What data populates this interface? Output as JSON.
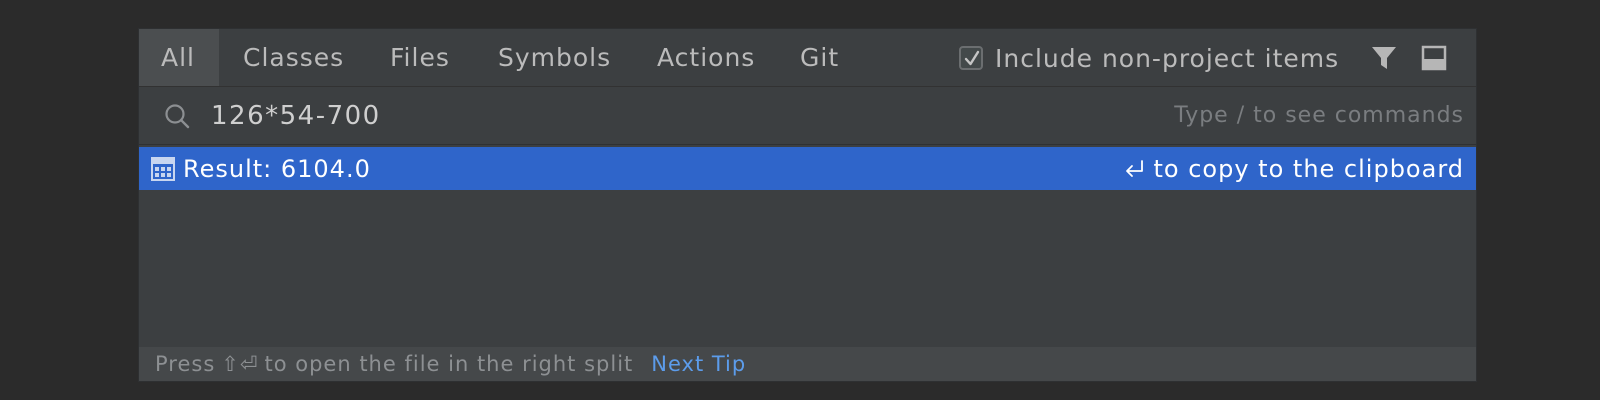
{
  "tabs": [
    {
      "label": "All",
      "active": true
    },
    {
      "label": "Classes",
      "active": false
    },
    {
      "label": "Files",
      "active": false
    },
    {
      "label": "Symbols",
      "active": false
    },
    {
      "label": "Actions",
      "active": false
    },
    {
      "label": "Git",
      "active": false
    }
  ],
  "options": {
    "include_non_project_label": "Include non-project items",
    "include_non_project_checked": true,
    "filter_icon": "filter-icon",
    "preview_icon": "preview-panel-icon"
  },
  "search": {
    "value": "126*54-700",
    "hint": "Type / to see commands",
    "icon": "search-icon"
  },
  "result": {
    "icon": "calculator-icon",
    "text": "Result: 6104.0",
    "hint_icon": "enter-key-icon",
    "hint": "to copy to the clipboard"
  },
  "footer": {
    "press_label": "Press",
    "keys": "⇧⏎",
    "rest_label": "to open the file in the right split",
    "next_tip_label": "Next Tip"
  },
  "colors": {
    "background": "#2b2b2b",
    "popup": "#3c3f41",
    "selection": "#2f65ca",
    "link": "#5c9ceb"
  }
}
